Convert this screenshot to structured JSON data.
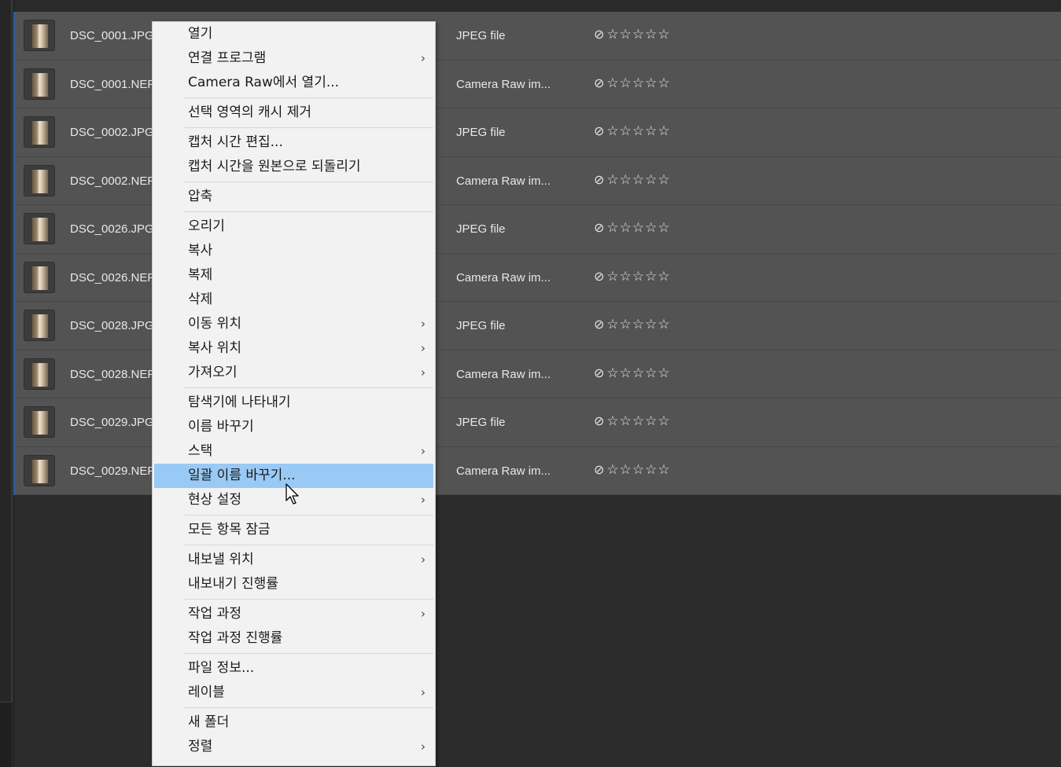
{
  "files": [
    {
      "name": "DSC_0001.JPG",
      "type": "JPEG file"
    },
    {
      "name": "DSC_0001.NEF",
      "type": "Camera Raw im..."
    },
    {
      "name": "DSC_0002.JPG",
      "type": "JPEG file"
    },
    {
      "name": "DSC_0002.NEF",
      "type": "Camera Raw im..."
    },
    {
      "name": "DSC_0026.JPG",
      "type": "JPEG file"
    },
    {
      "name": "DSC_0026.NEF",
      "type": "Camera Raw im..."
    },
    {
      "name": "DSC_0028.JPG",
      "type": "JPEG file"
    },
    {
      "name": "DSC_0028.NEF",
      "type": "Camera Raw im..."
    },
    {
      "name": "DSC_0029.JPG",
      "type": "JPEG file"
    },
    {
      "name": "DSC_0029.NEF",
      "type": "Camera Raw im..."
    }
  ],
  "rating": {
    "reject_icon": "⃠",
    "stars": 5,
    "value": 0
  },
  "menu": {
    "groups": [
      [
        {
          "label": "열기",
          "submenu": false
        },
        {
          "label": "연결 프로그램",
          "submenu": true
        },
        {
          "label": "Camera Raw에서 열기...",
          "submenu": false
        }
      ],
      [
        {
          "label": "선택 영역의 캐시 제거",
          "submenu": false
        }
      ],
      [
        {
          "label": "캡처 시간 편집...",
          "submenu": false
        },
        {
          "label": "캡처 시간을 원본으로 되돌리기",
          "submenu": false
        }
      ],
      [
        {
          "label": "압축",
          "submenu": false
        }
      ],
      [
        {
          "label": "오리기",
          "submenu": false
        },
        {
          "label": "복사",
          "submenu": false
        },
        {
          "label": "복제",
          "submenu": false
        },
        {
          "label": "삭제",
          "submenu": false
        },
        {
          "label": "이동 위치",
          "submenu": true
        },
        {
          "label": "복사 위치",
          "submenu": true
        },
        {
          "label": "가져오기",
          "submenu": true
        }
      ],
      [
        {
          "label": "탐색기에 나타내기",
          "submenu": false
        },
        {
          "label": "이름 바꾸기",
          "submenu": false
        },
        {
          "label": "스택",
          "submenu": true
        },
        {
          "label": "일괄 이름 바꾸기...",
          "submenu": false,
          "highlighted": true
        },
        {
          "label": "현상 설정",
          "submenu": true
        }
      ],
      [
        {
          "label": "모든 항목 잠금",
          "submenu": false
        }
      ],
      [
        {
          "label": "내보낼 위치",
          "submenu": true
        },
        {
          "label": "내보내기 진행률",
          "submenu": false
        }
      ],
      [
        {
          "label": "작업 과정",
          "submenu": true
        },
        {
          "label": "작업 과정 진행률",
          "submenu": false
        }
      ],
      [
        {
          "label": "파일 정보...",
          "submenu": false
        },
        {
          "label": "레이블",
          "submenu": true
        }
      ],
      [
        {
          "label": "새 폴더",
          "submenu": false
        },
        {
          "label": "정렬",
          "submenu": true
        }
      ]
    ]
  },
  "colors": {
    "highlight": "#99c9f5",
    "accent": "#2f5fa8"
  }
}
